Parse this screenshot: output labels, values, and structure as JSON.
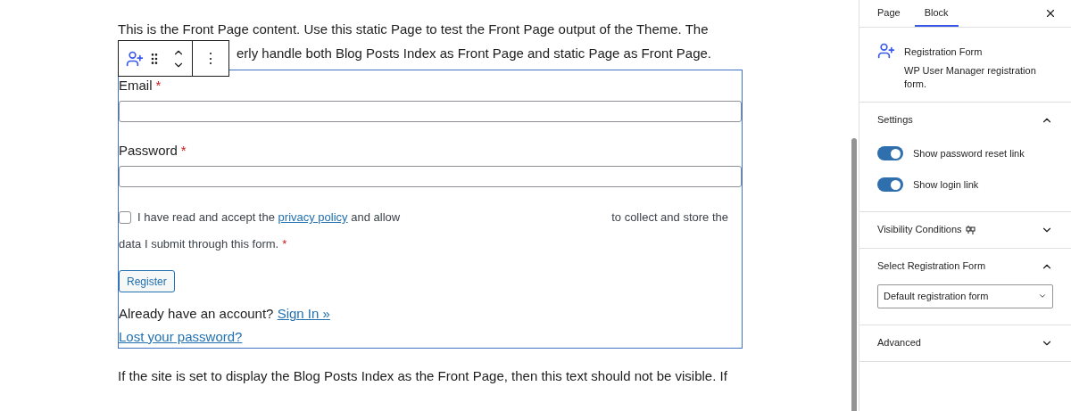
{
  "content": {
    "intro_line": "This is the Front Page content. Use this static Page to test the Front Page output of the Theme. The",
    "intro_line_visible_rest": "erly handle both Blog Posts Index as Front Page and static Page as Front Page.",
    "outro_line": "If the site is set to display the Blog Posts Index as the Front Page, then this text should not be visible. If"
  },
  "block_toolbar": {
    "more_label": "⋮"
  },
  "form": {
    "required_mark": "*",
    "fields": [
      {
        "label": "Email",
        "required": true
      },
      {
        "label": "Password",
        "required": true
      }
    ],
    "consent": {
      "checked": false,
      "before": "I have read and accept the",
      "link": "privacy policy",
      "after": "and allow",
      "right": "to collect and store the",
      "line_2": "data I submit through this form.",
      "required": true
    },
    "submit": "Register",
    "account_text": "Already have an account?",
    "sign_in": "Sign In »",
    "lost_password": "Lost your password?"
  },
  "sidebar": {
    "tabs": [
      {
        "label": "Page",
        "selected": false
      },
      {
        "label": "Block",
        "selected": true
      }
    ],
    "block": {
      "title": "Registration Form",
      "description": "WP User Manager registration form."
    },
    "panels": [
      {
        "kind": "toggles",
        "title": "Settings",
        "expanded": true,
        "toggles": [
          {
            "label": "Show password reset link",
            "on": true
          },
          {
            "label": "Show login link",
            "on": true
          }
        ]
      },
      {
        "kind": "plain",
        "title": "Visibility Conditions",
        "expanded": false,
        "has_icon": true
      },
      {
        "kind": "select",
        "title": "Select Registration Form",
        "expanded": true,
        "value": "Default registration form"
      },
      {
        "kind": "plain",
        "title": "Advanced",
        "expanded": false
      }
    ]
  }
}
